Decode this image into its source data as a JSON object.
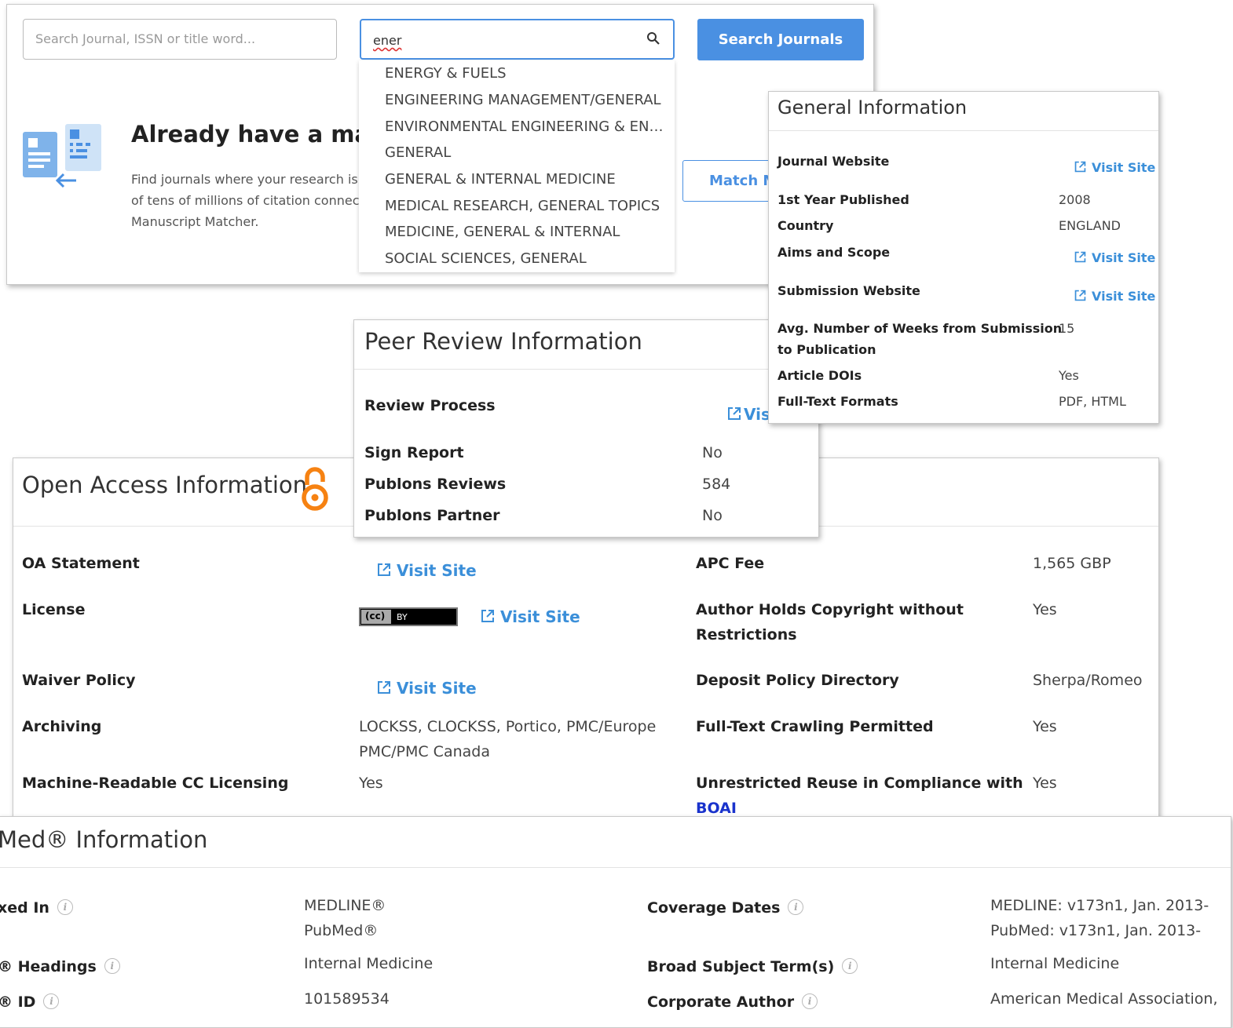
{
  "search": {
    "journal_placeholder": "Search Journal, ISSN or title word...",
    "category_value": "ener",
    "button_label": "Search Journals",
    "suggestions": [
      "ENERGY & FUELS",
      "ENGINEERING MANAGEMENT/GENERAL",
      "ENVIRONMENTAL ENGINEERING & EN…",
      "GENERAL",
      "GENERAL & INTERNAL MEDICINE",
      "MEDICAL RESEARCH, GENERAL TOPICS",
      "MEDICINE, GENERAL & INTERNAL",
      "SOCIAL SCIENCES, GENERAL"
    ],
    "manuscript_title": "Already have a manu",
    "manuscript_desc": [
      "Find journals where your research is r",
      "of tens of millions of citation connect",
      "Manuscript Matcher."
    ],
    "match_button": "Match M"
  },
  "general": {
    "title": "General Information",
    "visit_label": "Visit Site",
    "rows": {
      "website": "Journal Website",
      "year_label": "1st Year Published",
      "year_value": "2008",
      "country_label": "Country",
      "country_value": "ENGLAND",
      "aims": "Aims and Scope",
      "submission": "Submission Website",
      "weeks_label_1": "Avg. Number of Weeks from Submission",
      "weeks_label_2": "to Publication",
      "weeks_value": "15",
      "dois_label": "Article DOIs",
      "dois_value": "Yes",
      "formats_label": "Full-Text Formats",
      "formats_value": "PDF, HTML"
    }
  },
  "peer": {
    "title": "Peer Review Information",
    "review_process": "Review Process",
    "visit_partial": "Visi",
    "sign_label": "Sign Report",
    "sign_value": "No",
    "reviews_label": "Publons Reviews",
    "reviews_value": "584",
    "partner_label": "Publons Partner",
    "partner_value": "No"
  },
  "oa": {
    "title": "Open Access Information",
    "visit_label": "Visit Site",
    "license_badge_cc": "(cc)",
    "license_badge_by": "BY",
    "oa_statement": "OA Statement",
    "license": "License",
    "waiver": "Waiver Policy",
    "archiving": "Archiving",
    "archiving_value_1": "LOCKSS, CLOCKSS, Portico, PMC/Europe",
    "archiving_value_2": "PMC/PMC Canada",
    "machine_label": "Machine-Readable CC Licensing",
    "machine_value": "Yes",
    "apc_label": "APC Fee",
    "apc_value": "1,565 GBP",
    "copyright_1": "Author Holds Copyright without",
    "copyright_2": "Restrictions",
    "copyright_value": "Yes",
    "deposit_label": "Deposit Policy Directory",
    "deposit_value": "Sherpa/Romeo",
    "crawl_label": "Full-Text Crawling Permitted",
    "crawl_value": "Yes",
    "reuse_1": "Unrestricted Reuse in Compliance with",
    "reuse_link": "BOAI",
    "reuse_value": "Yes"
  },
  "pubmed": {
    "title": "Med® Information",
    "indexed_label": "xed In",
    "indexed_v1": "MEDLINE®",
    "indexed_v2": "PubMed®",
    "headings_label": "® Headings",
    "headings_value": "Internal Medicine",
    "id_label": "® ID",
    "id_value": "101589534",
    "coverage_label": "Coverage Dates",
    "coverage_v1": "MEDLINE: v173n1, Jan. 2013-",
    "coverage_v2": "PubMed: v173n1, Jan. 2013-",
    "broad_label": "Broad Subject Term(s)",
    "broad_value": "Internal Medicine",
    "corp_label": "Corporate Author",
    "corp_value": "American Medical Association,",
    "info_glyph": "i"
  },
  "colors": {
    "accent": "#4a90e2",
    "link": "#3b8fd9",
    "oa_orange": "#f68212",
    "boai": "#1a33cc"
  }
}
